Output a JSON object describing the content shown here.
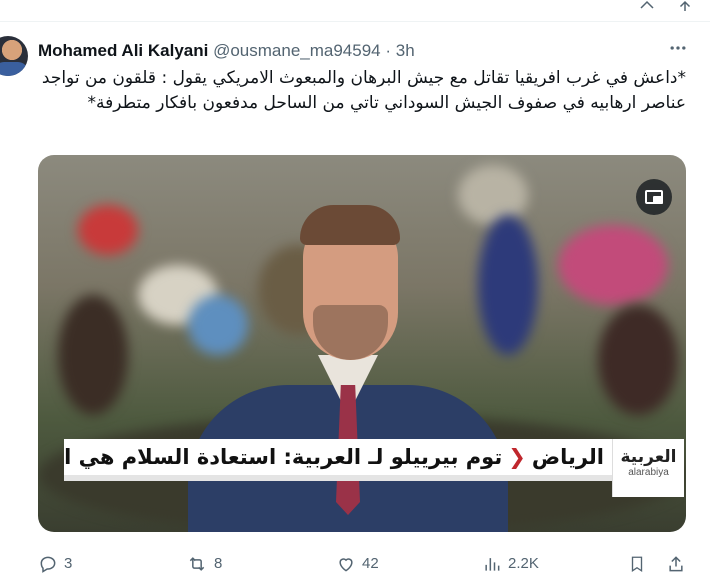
{
  "top_actions": [
    {
      "icon": "share-icon"
    },
    {
      "icon": "upload-icon"
    }
  ],
  "tweet": {
    "author_name": "Mohamed Ali Kalyani",
    "handle": "@ousmane_ma94594",
    "separator": "·",
    "time": "3h",
    "more_icon": "more-icon",
    "text": "*داعش في غرب افريقيا تقاتل مع جيش البرهان والمبعوث الامريكي يقول : قلقون من تواجد عناصر ارهابيه في صفوف الجيش السوداني تاتي من الساحل مدفعون بافكار متطرفة*",
    "media": {
      "pip_icon": "picture-in-picture-icon",
      "lower_third": {
        "location": "الرياض",
        "headline": "توم بيرييلو لـ العربية: استعادة السلام هي الحل لوقف التدخلات السلبية",
        "logo_ar": "العربية",
        "logo_en": "alarabiya"
      }
    },
    "actions": {
      "replies": "3",
      "retweets": "8",
      "likes": "42",
      "views": "2.2K"
    }
  },
  "colors": {
    "text": "#0f1419",
    "secondary": "#536471",
    "accent_red": "#c0272d"
  }
}
